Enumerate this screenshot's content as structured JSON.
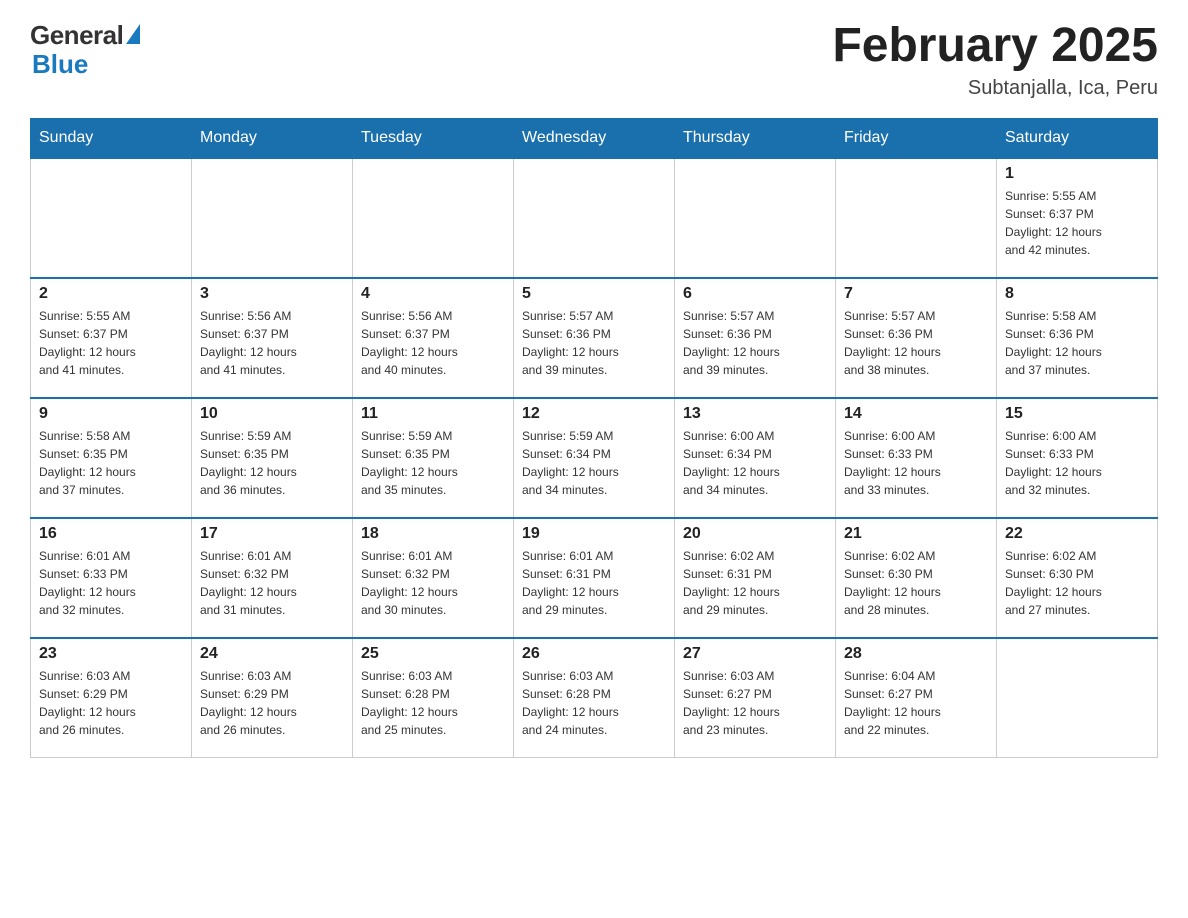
{
  "header": {
    "logo_general": "General",
    "logo_blue": "Blue",
    "month_title": "February 2025",
    "subtitle": "Subtanjalla, Ica, Peru"
  },
  "days_of_week": [
    "Sunday",
    "Monday",
    "Tuesday",
    "Wednesday",
    "Thursday",
    "Friday",
    "Saturday"
  ],
  "weeks": [
    [
      {
        "day": "",
        "info": ""
      },
      {
        "day": "",
        "info": ""
      },
      {
        "day": "",
        "info": ""
      },
      {
        "day": "",
        "info": ""
      },
      {
        "day": "",
        "info": ""
      },
      {
        "day": "",
        "info": ""
      },
      {
        "day": "1",
        "info": "Sunrise: 5:55 AM\nSunset: 6:37 PM\nDaylight: 12 hours\nand 42 minutes."
      }
    ],
    [
      {
        "day": "2",
        "info": "Sunrise: 5:55 AM\nSunset: 6:37 PM\nDaylight: 12 hours\nand 41 minutes."
      },
      {
        "day": "3",
        "info": "Sunrise: 5:56 AM\nSunset: 6:37 PM\nDaylight: 12 hours\nand 41 minutes."
      },
      {
        "day": "4",
        "info": "Sunrise: 5:56 AM\nSunset: 6:37 PM\nDaylight: 12 hours\nand 40 minutes."
      },
      {
        "day": "5",
        "info": "Sunrise: 5:57 AM\nSunset: 6:36 PM\nDaylight: 12 hours\nand 39 minutes."
      },
      {
        "day": "6",
        "info": "Sunrise: 5:57 AM\nSunset: 6:36 PM\nDaylight: 12 hours\nand 39 minutes."
      },
      {
        "day": "7",
        "info": "Sunrise: 5:57 AM\nSunset: 6:36 PM\nDaylight: 12 hours\nand 38 minutes."
      },
      {
        "day": "8",
        "info": "Sunrise: 5:58 AM\nSunset: 6:36 PM\nDaylight: 12 hours\nand 37 minutes."
      }
    ],
    [
      {
        "day": "9",
        "info": "Sunrise: 5:58 AM\nSunset: 6:35 PM\nDaylight: 12 hours\nand 37 minutes."
      },
      {
        "day": "10",
        "info": "Sunrise: 5:59 AM\nSunset: 6:35 PM\nDaylight: 12 hours\nand 36 minutes."
      },
      {
        "day": "11",
        "info": "Sunrise: 5:59 AM\nSunset: 6:35 PM\nDaylight: 12 hours\nand 35 minutes."
      },
      {
        "day": "12",
        "info": "Sunrise: 5:59 AM\nSunset: 6:34 PM\nDaylight: 12 hours\nand 34 minutes."
      },
      {
        "day": "13",
        "info": "Sunrise: 6:00 AM\nSunset: 6:34 PM\nDaylight: 12 hours\nand 34 minutes."
      },
      {
        "day": "14",
        "info": "Sunrise: 6:00 AM\nSunset: 6:33 PM\nDaylight: 12 hours\nand 33 minutes."
      },
      {
        "day": "15",
        "info": "Sunrise: 6:00 AM\nSunset: 6:33 PM\nDaylight: 12 hours\nand 32 minutes."
      }
    ],
    [
      {
        "day": "16",
        "info": "Sunrise: 6:01 AM\nSunset: 6:33 PM\nDaylight: 12 hours\nand 32 minutes."
      },
      {
        "day": "17",
        "info": "Sunrise: 6:01 AM\nSunset: 6:32 PM\nDaylight: 12 hours\nand 31 minutes."
      },
      {
        "day": "18",
        "info": "Sunrise: 6:01 AM\nSunset: 6:32 PM\nDaylight: 12 hours\nand 30 minutes."
      },
      {
        "day": "19",
        "info": "Sunrise: 6:01 AM\nSunset: 6:31 PM\nDaylight: 12 hours\nand 29 minutes."
      },
      {
        "day": "20",
        "info": "Sunrise: 6:02 AM\nSunset: 6:31 PM\nDaylight: 12 hours\nand 29 minutes."
      },
      {
        "day": "21",
        "info": "Sunrise: 6:02 AM\nSunset: 6:30 PM\nDaylight: 12 hours\nand 28 minutes."
      },
      {
        "day": "22",
        "info": "Sunrise: 6:02 AM\nSunset: 6:30 PM\nDaylight: 12 hours\nand 27 minutes."
      }
    ],
    [
      {
        "day": "23",
        "info": "Sunrise: 6:03 AM\nSunset: 6:29 PM\nDaylight: 12 hours\nand 26 minutes."
      },
      {
        "day": "24",
        "info": "Sunrise: 6:03 AM\nSunset: 6:29 PM\nDaylight: 12 hours\nand 26 minutes."
      },
      {
        "day": "25",
        "info": "Sunrise: 6:03 AM\nSunset: 6:28 PM\nDaylight: 12 hours\nand 25 minutes."
      },
      {
        "day": "26",
        "info": "Sunrise: 6:03 AM\nSunset: 6:28 PM\nDaylight: 12 hours\nand 24 minutes."
      },
      {
        "day": "27",
        "info": "Sunrise: 6:03 AM\nSunset: 6:27 PM\nDaylight: 12 hours\nand 23 minutes."
      },
      {
        "day": "28",
        "info": "Sunrise: 6:04 AM\nSunset: 6:27 PM\nDaylight: 12 hours\nand 22 minutes."
      },
      {
        "day": "",
        "info": ""
      }
    ]
  ]
}
